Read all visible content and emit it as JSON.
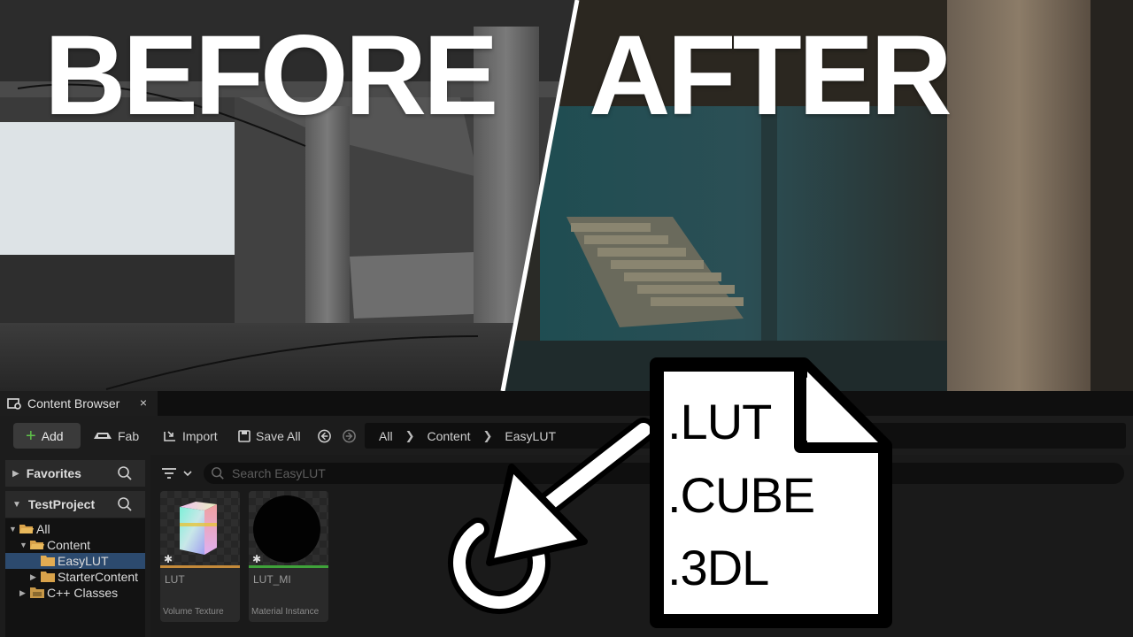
{
  "scene": {
    "before_label": "BEFORE",
    "after_label": "AFTER"
  },
  "content_browser": {
    "tab_title": "Content Browser",
    "tab_close": "×",
    "toolbar": {
      "add_label": "Add",
      "fab_label": "Fab",
      "import_label": "Import",
      "save_all_label": "Save All"
    },
    "breadcrumb": [
      "All",
      "Content",
      "EasyLUT"
    ],
    "sidebar": {
      "favorites_label": "Favorites",
      "project_label": "TestProject",
      "tree": [
        {
          "label": "All",
          "level": 0
        },
        {
          "label": "Content",
          "level": 1
        },
        {
          "label": "EasyLUT",
          "level": 2,
          "selected": true
        },
        {
          "label": "StarterContent",
          "level": 2
        },
        {
          "label": "C++ Classes",
          "level": 1
        }
      ]
    },
    "search_placeholder": "Search EasyLUT",
    "assets": [
      {
        "name": "LUT",
        "type": "Volume Texture",
        "accent_color": "#c48a3a"
      },
      {
        "name": "LUT_MI",
        "type": "Material Instance",
        "accent_color": "#3fa23a"
      }
    ]
  },
  "overlay": {
    "file_extensions": [
      ".LUT",
      ".CUBE",
      ".3DL"
    ],
    "icon": "drag-arrow-icon"
  }
}
